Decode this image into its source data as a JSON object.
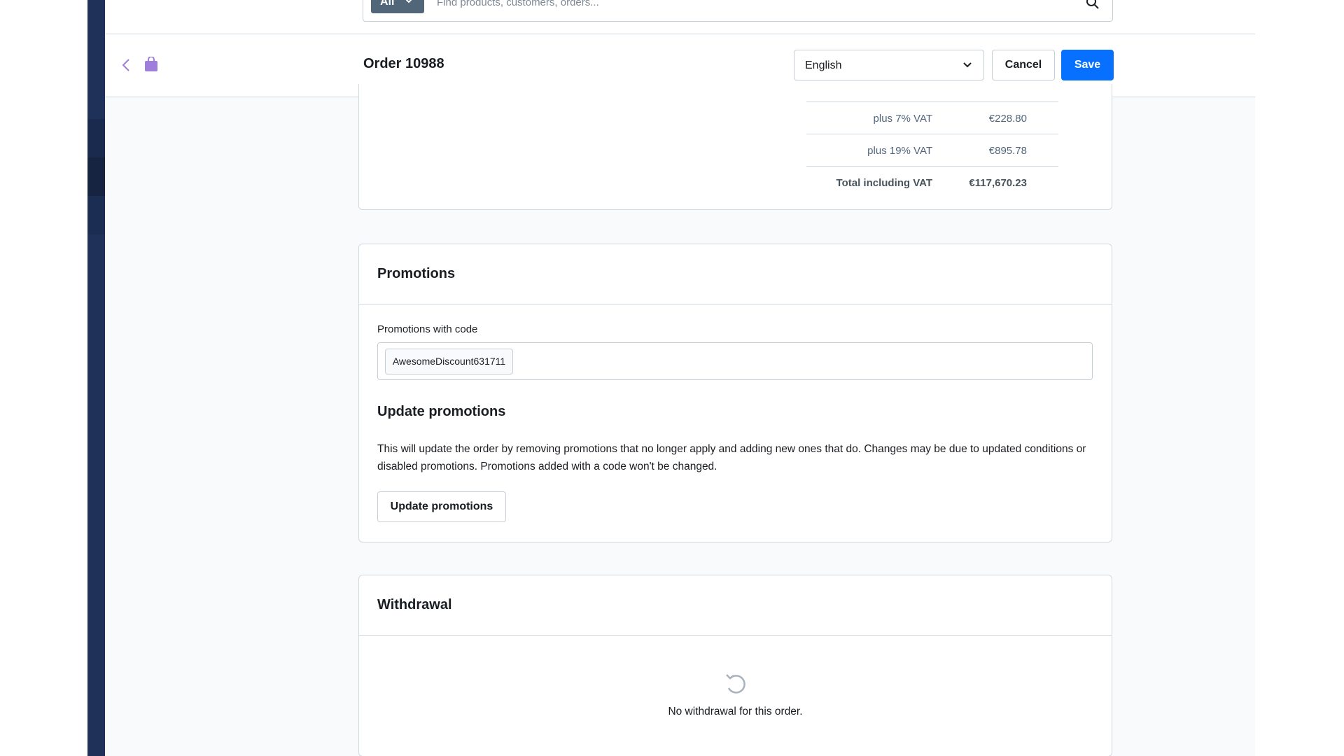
{
  "topbar": {
    "search_type": "All",
    "search_placeholder": "Find products, customers, orders..."
  },
  "header": {
    "title": "Order 10988",
    "language": "English",
    "cancel_label": "Cancel",
    "save_label": "Save"
  },
  "totals": {
    "rows": [
      {
        "label": "plus 7% VAT",
        "value": "€228.80"
      },
      {
        "label": "plus 19% VAT",
        "value": "€895.78"
      },
      {
        "label": "Total including VAT",
        "value": "€117,670.23"
      }
    ]
  },
  "promotions": {
    "title": "Promotions",
    "code_label": "Promotions with code",
    "code": "AwesomeDiscount631711",
    "update_title": "Update promotions",
    "update_description": "This will update the order by removing promotions that no longer apply and adding new ones that do. Changes may be due to updated conditions or disabled promotions. Promotions added with a code won't be changed.",
    "update_button": "Update promotions"
  },
  "withdrawal": {
    "title": "Withdrawal",
    "empty_text": "No withdrawal for this order."
  },
  "colors": {
    "sidebar": "#1f3059",
    "primary": "#0870ff",
    "accent_icon": "#9e7ddb"
  }
}
